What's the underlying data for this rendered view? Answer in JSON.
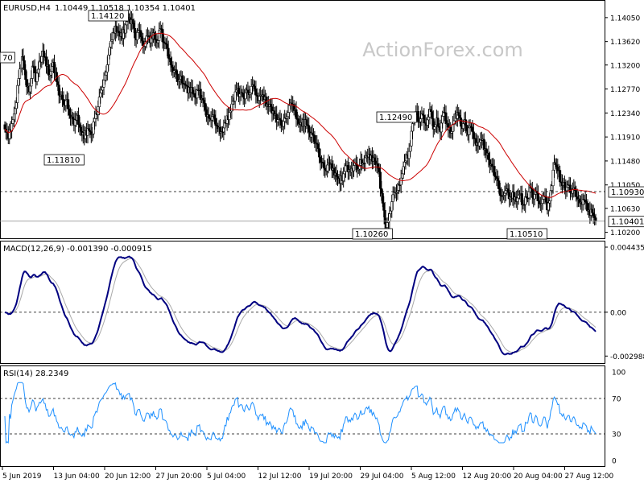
{
  "watermark": "ActionForex.com",
  "chart_data": [
    {
      "type": "candlestick",
      "title": "EURUSD,H4",
      "ohlc_text": "1.10449 1.10518 1.10354 1.10401",
      "ylim": [
        1.1018,
        1.1425
      ],
      "yticks": [
        "1.14050",
        "1.13620",
        "1.13200",
        "1.12770",
        "1.12340",
        "1.11910",
        "1.11480",
        "1.11050",
        "1.10630",
        "1.10200"
      ],
      "moving_average_color": "#cc0000",
      "up_color": "#000000",
      "down_color": "#000000",
      "close_series": [
        1.1205,
        1.1188,
        1.1215,
        1.1242,
        1.1296,
        1.1335,
        1.1294,
        1.1272,
        1.1318,
        1.129,
        1.1327,
        1.1345,
        1.1318,
        1.1302,
        1.1325,
        1.129,
        1.1264,
        1.1249,
        1.1258,
        1.1225,
        1.1212,
        1.123,
        1.1201,
        1.1188,
        1.1206,
        1.1195,
        1.1224,
        1.1245,
        1.1275,
        1.1302,
        1.1338,
        1.1365,
        1.139,
        1.1378,
        1.1368,
        1.1392,
        1.1405,
        1.1395,
        1.1365,
        1.1382,
        1.1355,
        1.1372,
        1.136,
        1.1378,
        1.136,
        1.1385,
        1.136,
        1.135,
        1.132,
        1.131,
        1.129,
        1.13,
        1.1285,
        1.127,
        1.128,
        1.1262,
        1.1275,
        1.126,
        1.124,
        1.1225,
        1.1228,
        1.1212,
        1.1208,
        1.12,
        1.1215,
        1.1235,
        1.1255,
        1.1275,
        1.1268,
        1.1262,
        1.1275,
        1.127,
        1.1282,
        1.1264,
        1.1266,
        1.1258,
        1.125,
        1.1245,
        1.123,
        1.1222,
        1.1212,
        1.1225,
        1.1235,
        1.125,
        1.124,
        1.1215,
        1.121,
        1.1222,
        1.12,
        1.1195,
        1.118,
        1.1155,
        1.1145,
        1.113,
        1.1142,
        1.1135,
        1.112,
        1.1108,
        1.1125,
        1.114,
        1.1128,
        1.114,
        1.1132,
        1.115,
        1.1144,
        1.1155,
        1.1158,
        1.1148,
        1.1135,
        1.109,
        1.1035,
        1.104,
        1.1075,
        1.109,
        1.1105,
        1.1125,
        1.1148,
        1.1165,
        1.1215,
        1.1235,
        1.1218,
        1.123,
        1.1212,
        1.124,
        1.1205,
        1.1225,
        1.12,
        1.1235,
        1.1215,
        1.1198,
        1.122,
        1.1235,
        1.121,
        1.1222,
        1.1195,
        1.1208,
        1.1188,
        1.1175,
        1.1185,
        1.117,
        1.115,
        1.1138,
        1.112,
        1.1098,
        1.1085,
        1.1095,
        1.108,
        1.1092,
        1.1075,
        1.1088,
        1.107,
        1.1082,
        1.11,
        1.108,
        1.109,
        1.107,
        1.1085,
        1.106,
        1.1095,
        1.1145,
        1.113,
        1.111,
        1.11,
        1.1105,
        1.109,
        1.1095,
        1.108,
        1.107,
        1.1075,
        1.106,
        1.1055,
        1.104
      ],
      "labels": [
        {
          "text": "1.14120"
        },
        {
          "text": "1.11810"
        },
        {
          "text": "1.12490"
        },
        {
          "text": "1.10260"
        },
        {
          "text": "1.10510"
        },
        {
          "text": "70"
        }
      ],
      "hline_label": "1.10930",
      "current_price_label": "1.10401"
    },
    {
      "type": "line",
      "title": "MACD(12,26,9) -0.001390 -0.000915",
      "yticks": [
        "0.004435",
        "0.00",
        "-0.002988"
      ],
      "ylim": [
        -0.0033,
        0.0046
      ],
      "series": [
        {
          "name": "MACD",
          "color": "#000080"
        },
        {
          "name": "Signal",
          "color": "#a9a9a9"
        }
      ]
    },
    {
      "type": "line",
      "title": "RSI(14) 28.2349",
      "yticks": [
        "100",
        "70",
        "30",
        "0"
      ],
      "ylim": [
        0,
        100
      ],
      "levels": [
        70,
        30
      ],
      "series": [
        {
          "name": "RSI",
          "color": "#1e90ff"
        }
      ]
    }
  ],
  "x_axis": [
    "5 Jun 2019",
    "13 Jun 04:00",
    "20 Jun 12:00",
    "27 Jun 20:00",
    "5 Jul 04:00",
    "12 Jul 12:00",
    "19 Jul 20:00",
    "29 Jul 04:00",
    "5 Aug 12:00",
    "12 Aug 20:00",
    "20 Aug 04:00",
    "27 Aug 12:00"
  ]
}
